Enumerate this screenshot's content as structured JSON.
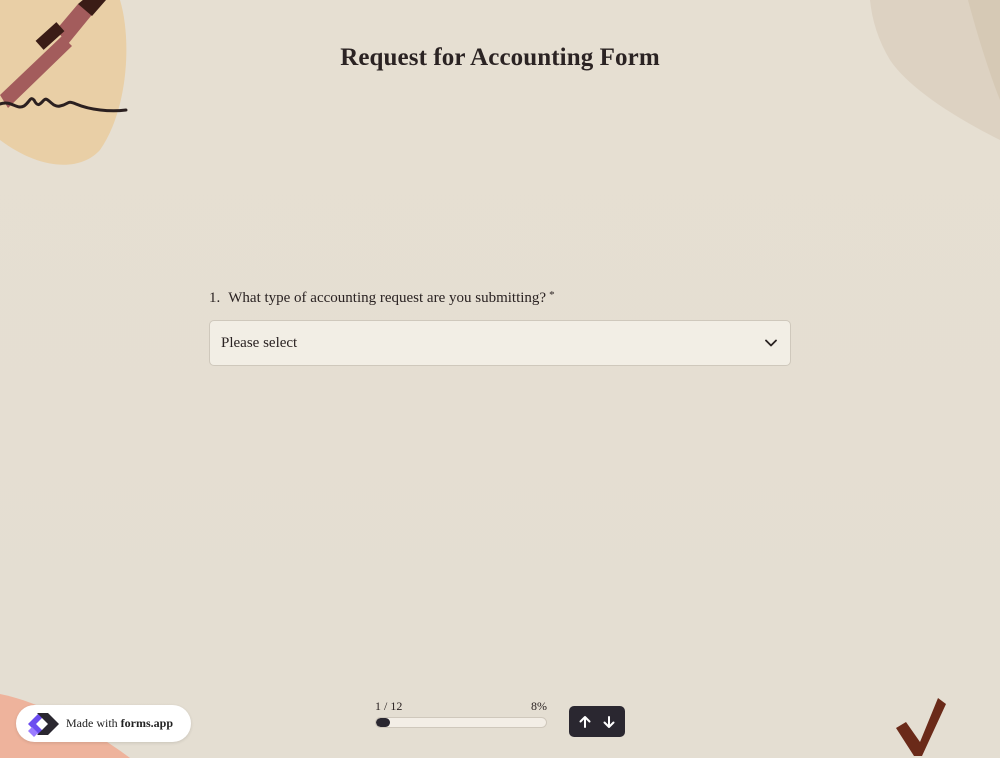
{
  "form": {
    "title": "Request for Accounting Form"
  },
  "question": {
    "number": "1.",
    "text": "What type of accounting request are you submitting?",
    "required_marker": "*",
    "select": {
      "selected": "Please select"
    }
  },
  "progress": {
    "position": "1 / 12",
    "percent_label": "8%",
    "percent": 8
  },
  "badge": {
    "prefix": "Made with",
    "brand": "forms.app"
  },
  "icons": {
    "select_toggle": "chevron-down-icon",
    "prev": "arrow-up-icon",
    "next": "arrow-down-icon",
    "logo": "forms-app-logo",
    "decor_pen": "pen-icon",
    "decor_check": "checkmark-icon"
  },
  "colors": {
    "background": "#e6dfd2",
    "accent_dark": "#2a2730",
    "select_bg": "#f2eee5",
    "blob_peach": "#e9cfa6",
    "blob_salmon": "#eeb39c",
    "pen": "#a35c5c",
    "check": "#6a2a19",
    "logo_purple": "#6b4cf0"
  }
}
